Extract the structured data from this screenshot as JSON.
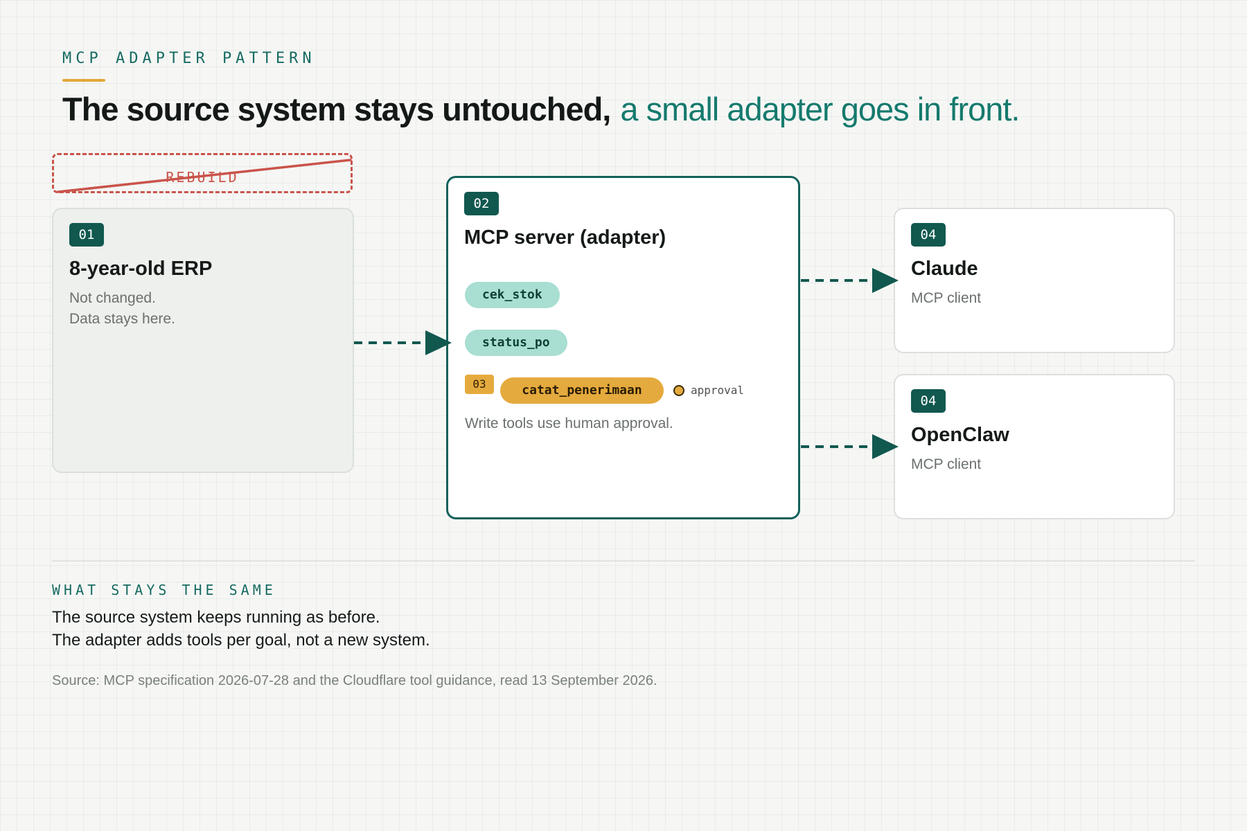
{
  "header": {
    "eyebrow": "MCP ADAPTER PATTERN",
    "headline_strong": "The source system stays untouched,",
    "headline_soft": "a small adapter goes in front."
  },
  "rebuild": {
    "label": "REBUILD"
  },
  "erp": {
    "badge": "01",
    "title": "8-year-old ERP",
    "lines": [
      "Not changed.",
      "Data stays here."
    ]
  },
  "mcp": {
    "badge": "02",
    "title": "MCP server (adapter)",
    "tools": [
      "cek_stok",
      "status_po"
    ],
    "write_badge": "03",
    "write_tool": "catat_penerimaan",
    "approval_label": "approval",
    "note": "Write tools use human approval."
  },
  "clients": [
    {
      "badge": "04",
      "title": "Claude",
      "subtitle": "MCP client"
    },
    {
      "badge": "04",
      "title": "OpenClaw",
      "subtitle": "MCP client"
    }
  ],
  "footer": {
    "section_label": "WHAT STAYS THE SAME",
    "lines": [
      "The source system keeps running as before.",
      "The adapter adds tools per goal, not a new system."
    ],
    "source": "Source: MCP specification 2026-07-28 and the Cloudflare tool guidance, read 13 September 2026."
  },
  "colors": {
    "accent_green": "#11584f",
    "teal_text": "#157a6d",
    "read_chip": "#a9ded3",
    "write_chip": "#e5aa3d",
    "strike_red": "#c9544b"
  }
}
